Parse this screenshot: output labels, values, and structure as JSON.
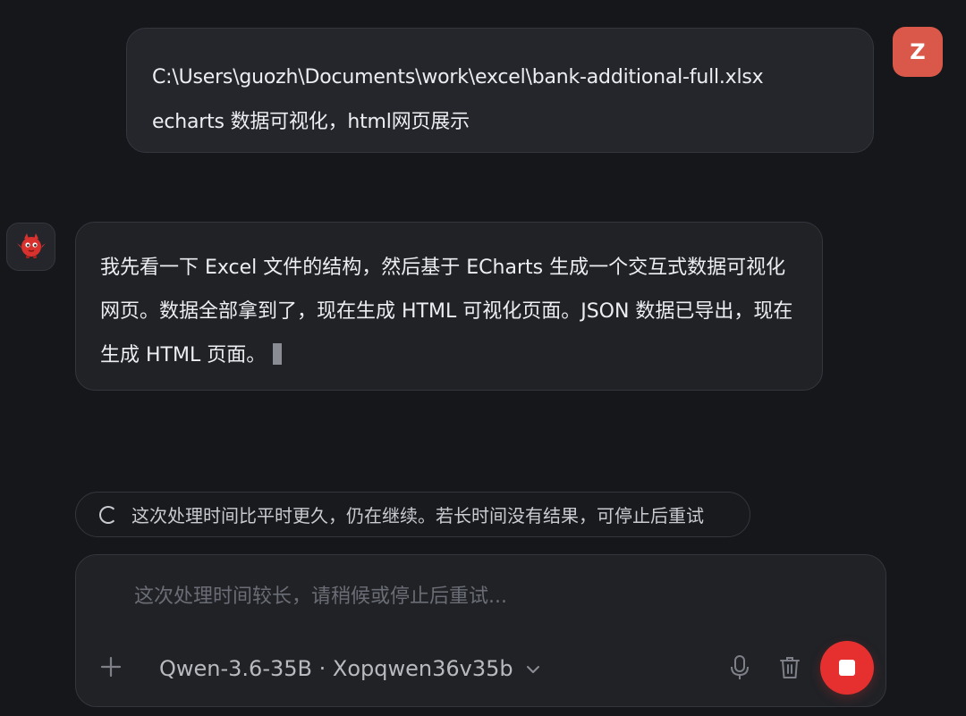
{
  "user_message": {
    "avatar_letter": "Z",
    "lines": [
      "C:\\Users\\guozh\\Documents\\work\\excel\\bank-additional-full.xlsx",
      "echarts 数据可视化，html网页展示"
    ]
  },
  "assistant_message": {
    "avatar_icon": "red-bot-mascot-icon",
    "text": "我先看一下 Excel 文件的结构，然后基于 ECharts 生成一个交互式数据可视化网页。数据全部拿到了，现在生成 HTML 可视化页面。JSON 数据已导出，现在生成 HTML 页面。"
  },
  "status": {
    "text": "这次处理时间比平时更久，仍在继续。若长时间没有结果，可停止后重试"
  },
  "composer": {
    "placeholder": "这次处理时间较长，请稍候或停止后重试...",
    "model_label": "Qwen-3.6-35B · Xopqwen36v35b",
    "icons": {
      "add": "plus-icon",
      "dropdown": "chevron-down-icon",
      "mic": "microphone-icon",
      "clear": "trash-icon",
      "stop": "stop-icon"
    }
  },
  "colors": {
    "background": "#16171b",
    "bubble": "#24262c",
    "user_avatar": "#d9584a",
    "stop_button": "#e5302f"
  }
}
